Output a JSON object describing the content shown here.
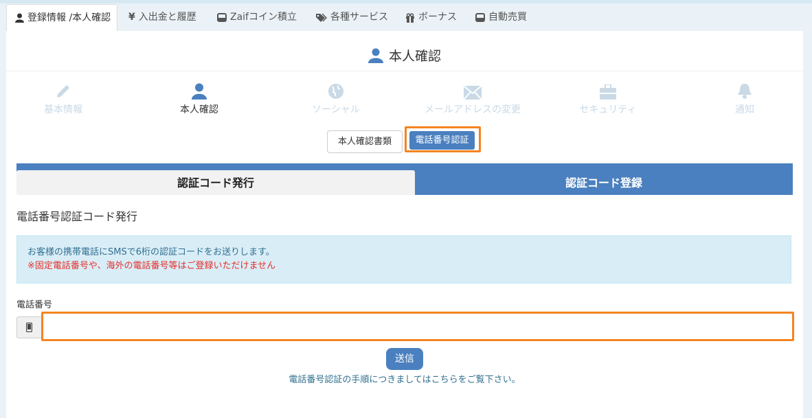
{
  "tabs": [
    {
      "label": "登録情報 /本人確認",
      "icon": "user-icon"
    },
    {
      "label": "入出金と履歴",
      "icon": "yen-icon"
    },
    {
      "label": "Zaifコイン積立",
      "icon": "inbox-icon"
    },
    {
      "label": "各種サービス",
      "icon": "tags-icon"
    },
    {
      "label": "ボーナス",
      "icon": "gift-icon"
    },
    {
      "label": "自動売買",
      "icon": "inbox-icon"
    }
  ],
  "page_title": "本人確認",
  "steps": [
    {
      "label": "基本情報",
      "icon": "pencil-icon"
    },
    {
      "label": "本人確認",
      "icon": "user-icon"
    },
    {
      "label": "ソーシャル",
      "icon": "globe-icon"
    },
    {
      "label": "メールアドレスの変更",
      "icon": "envelope-icon"
    },
    {
      "label": "セキュリティ",
      "icon": "briefcase-icon"
    },
    {
      "label": "通知",
      "icon": "bell-icon"
    }
  ],
  "subtabs": {
    "doc": "本人確認書類",
    "phone": "電話番号認証"
  },
  "segments": {
    "issue": "認証コード発行",
    "register": "認証コード登録"
  },
  "section_title": "電話番号認証コード発行",
  "info": {
    "line1": "お客様の携帯電話にSMSで6桁の認証コードをお送りします。",
    "line2": "※固定電話番号や、海外の電話番号等はご登録いただけません"
  },
  "phone_field": {
    "label": "電話番号",
    "value": "",
    "placeholder": ""
  },
  "send_button": "送信",
  "help_link": "電話番号認証の手順につきましてはこちらをご覧下さい。",
  "colors": {
    "primary": "#4a80bf",
    "highlight": "#f5841f",
    "info_bg": "#d9edf7",
    "warning_text": "#e5302a"
  }
}
